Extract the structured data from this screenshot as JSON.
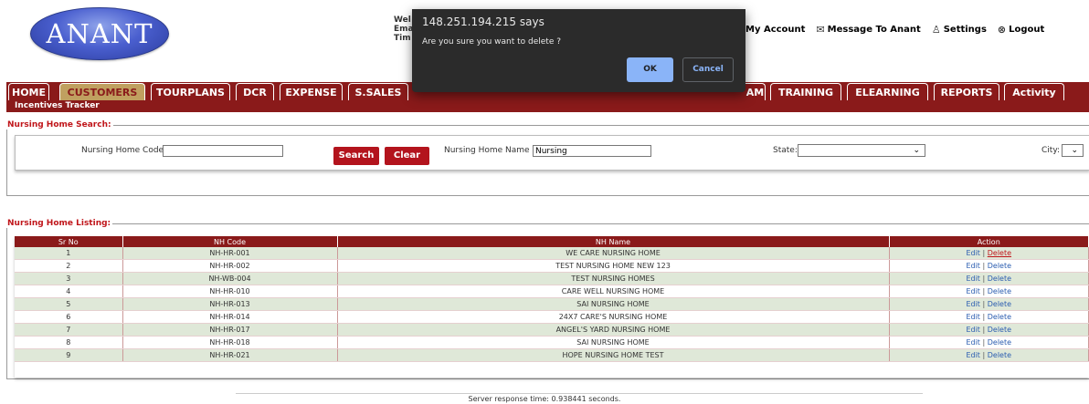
{
  "header": {
    "logo_text": "ANANT",
    "welcome_lines": [
      "Wel",
      "Ema",
      "Tim"
    ],
    "links": [
      {
        "icon": "user-icon",
        "label": "My Account"
      },
      {
        "icon": "envelope-icon",
        "label": "Message To Anant"
      },
      {
        "icon": "person-icon",
        "label": "Settings"
      },
      {
        "icon": "close-circle-icon",
        "label": "Logout"
      }
    ]
  },
  "nav": {
    "tabs": [
      "HOME",
      "CUSTOMERS",
      "TOURPLANS",
      "DCR",
      "EXPENSE",
      "S.SALES",
      "AM",
      "TRAINING",
      "ELEARNING",
      "REPORTS",
      "Activity"
    ],
    "active": "CUSTOMERS",
    "sub_item": "Incentives Tracker"
  },
  "search": {
    "legend": "Nursing Home Search:",
    "code_label": "Nursing Home Code",
    "code_value": "",
    "name_label": "Nursing Home Name",
    "name_value": "Nursing",
    "state_label": "State:",
    "state_value": "",
    "city_label": "City:",
    "city_value": "",
    "search_button": "Search",
    "clear_button": "Clear"
  },
  "listing": {
    "legend": "Nursing Home Listing:",
    "columns": [
      "Sr No",
      "NH Code",
      "NH Name",
      "Action"
    ],
    "rows": [
      {
        "sr": "1",
        "code": "NH-HR-001",
        "name": "WE CARE NURSING HOME"
      },
      {
        "sr": "2",
        "code": "NH-HR-002",
        "name": "TEST NURSING HOME NEW 123"
      },
      {
        "sr": "3",
        "code": "NH-WB-004",
        "name": "TEST NURSING HOMES"
      },
      {
        "sr": "4",
        "code": "NH-HR-010",
        "name": "CARE WELL NURSING HOME"
      },
      {
        "sr": "5",
        "code": "NH-HR-013",
        "name": "SAI NURSING HOME"
      },
      {
        "sr": "6",
        "code": "NH-HR-014",
        "name": "24X7 CARE'S NURSING HOME"
      },
      {
        "sr": "7",
        "code": "NH-HR-017",
        "name": "ANGEL'S YARD NURSING HOME"
      },
      {
        "sr": "8",
        "code": "NH-HR-018",
        "name": "SAI NURSING HOME"
      },
      {
        "sr": "9",
        "code": "NH-HR-021",
        "name": "HOPE NURSING HOME TEST"
      }
    ],
    "edit_label": "Edit",
    "delete_label": "Delete",
    "separator": "|"
  },
  "footer": {
    "text": "Server response time: 0.938441 seconds."
  },
  "dialog": {
    "title": "148.251.194.215 says",
    "message": "Are you sure you want to delete ?",
    "ok": "OK",
    "cancel": "Cancel"
  },
  "colors": {
    "brand": "#8a1a1a",
    "active_tab": "#c0a060",
    "button": "#b3141d",
    "link": "#2b5db0",
    "dialog_bg": "#2b2b2b",
    "dialog_accent": "#8ab4f8"
  }
}
